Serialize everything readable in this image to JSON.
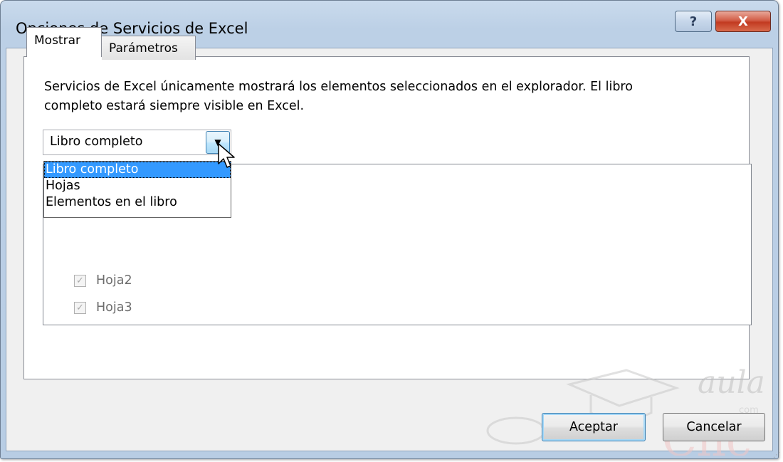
{
  "window": {
    "title": "Opciones de Servicios de Excel",
    "help_label": "?",
    "close_label": "X"
  },
  "tabs": [
    {
      "label": "Mostrar",
      "active": true
    },
    {
      "label": "Parámetros",
      "active": false
    }
  ],
  "description": {
    "line1": "Servicios de Excel únicamente mostrará los elementos seleccionados en el explorador. El libro",
    "line2": "completo estará siempre visible en Excel."
  },
  "combo": {
    "value": "Libro completo",
    "options": [
      "Libro completo",
      "Hojas",
      "Elementos en el libro"
    ]
  },
  "list": {
    "items": [
      {
        "label": "Hoja2",
        "checked": true,
        "enabled": false
      },
      {
        "label": "Hoja3",
        "checked": true,
        "enabled": false
      }
    ]
  },
  "buttons": {
    "accept": "Aceptar",
    "cancel": "Cancelar"
  },
  "watermark": {
    "line1": "aula",
    "line2": "Clic",
    "com": "com"
  },
  "colors": {
    "selection": "#3399ff",
    "title_bar": "#bcd0e6",
    "close_button": "#c23a21"
  }
}
